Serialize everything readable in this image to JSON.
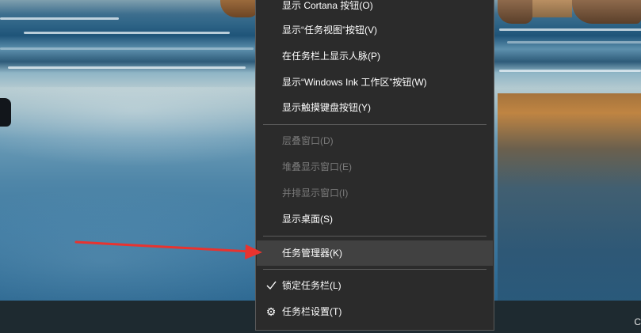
{
  "context_menu": {
    "items": [
      {
        "label": "显示 Cortana 按钮(O)"
      },
      {
        "label": "显示“任务视图”按钮(V)"
      },
      {
        "label": "在任务栏上显示人脉(P)"
      },
      {
        "label": "显示“Windows Ink 工作区”按钮(W)"
      },
      {
        "label": "显示触摸键盘按钮(Y)"
      },
      {
        "label": "层叠窗口(D)",
        "disabled": true
      },
      {
        "label": "堆叠显示窗口(E)",
        "disabled": true
      },
      {
        "label": "并排显示窗口(I)",
        "disabled": true
      },
      {
        "label": "显示桌面(S)"
      },
      {
        "label": "任务管理器(K)",
        "highlighted": true
      },
      {
        "label": "锁定任务栏(L)",
        "icon": "checkmark-icon",
        "checked": true
      },
      {
        "label": "任务栏设置(T)",
        "icon": "gear-icon"
      }
    ],
    "colors": {
      "background": "#2b2b2b",
      "border": "#595959",
      "text": "#ffffff",
      "disabled_text": "#7a7a7a",
      "highlight": "#414141",
      "separator": "#5c5c5c"
    }
  },
  "taskbar": {
    "clock_fragment": "C",
    "color": "#1e2a30"
  },
  "annotation": {
    "type": "arrow",
    "color": "#e8332f",
    "points_to": "任务管理器(K)"
  }
}
